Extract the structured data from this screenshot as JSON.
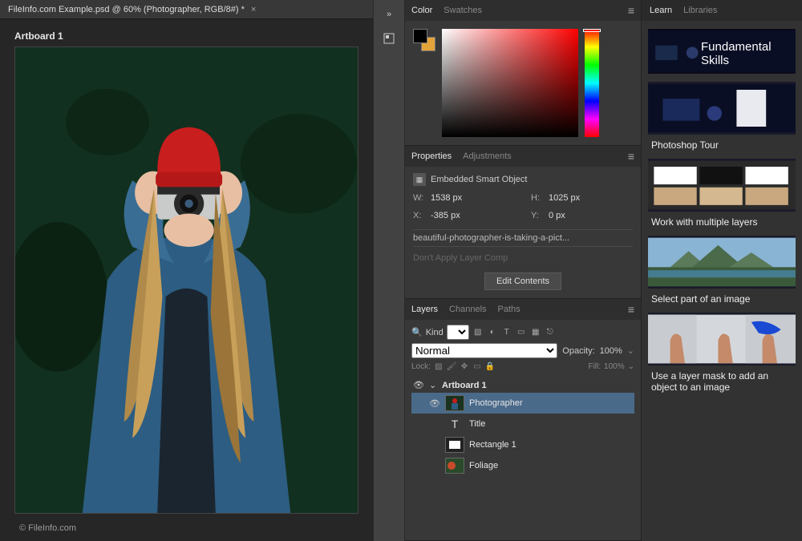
{
  "document": {
    "tab_title": "FileInfo.com Example.psd @ 60% (Photographer, RGB/8#) *",
    "artboard_label": "Artboard 1",
    "watermark": "© FileInfo.com"
  },
  "colorPanel": {
    "tab_color": "Color",
    "tab_swatches": "Swatches",
    "fg_color": "#000000",
    "bg_color": "#e2a33a"
  },
  "properties": {
    "tab_properties": "Properties",
    "tab_adjustments": "Adjustments",
    "object_type": "Embedded Smart Object",
    "w_label": "W:",
    "w_value": "1538 px",
    "h_label": "H:",
    "h_value": "1025 px",
    "x_label": "X:",
    "x_value": "-385 px",
    "y_label": "Y:",
    "y_value": "0 px",
    "filename": "beautiful-photographer-is-taking-a-pict...",
    "layer_comp_placeholder": "Don't Apply Layer Comp",
    "edit_button": "Edit Contents"
  },
  "layers": {
    "tab_layers": "Layers",
    "tab_channels": "Channels",
    "tab_paths": "Paths",
    "kind_label": "Kind",
    "blend_mode": "Normal",
    "opacity_label": "Opacity:",
    "opacity_value": "100%",
    "lock_label": "Lock:",
    "fill_label": "Fill:",
    "fill_value": "100%",
    "items": [
      {
        "name": "Artboard 1",
        "type": "artboard",
        "visible": true,
        "expanded": true
      },
      {
        "name": "Photographer",
        "type": "smartobject",
        "visible": true,
        "selected": true
      },
      {
        "name": "Title",
        "type": "text",
        "visible": false
      },
      {
        "name": "Rectangle 1",
        "type": "shape",
        "visible": false
      },
      {
        "name": "Foliage",
        "type": "image",
        "visible": false
      }
    ]
  },
  "learn": {
    "tab_learn": "Learn",
    "tab_libraries": "Libraries",
    "hero_title": "Fundamental Skills",
    "tiles": [
      {
        "caption": "Photoshop Tour"
      },
      {
        "caption": "Work with multiple layers"
      },
      {
        "caption": "Select part of an image"
      },
      {
        "caption": "Use a layer mask to add an object to an image"
      }
    ]
  }
}
